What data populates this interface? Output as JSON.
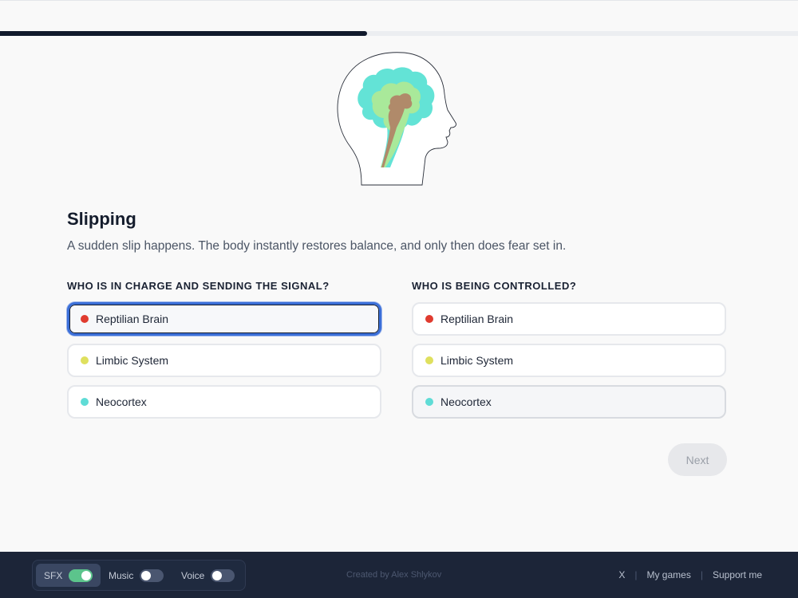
{
  "progress": {
    "fraction": 0.46
  },
  "illustration": {
    "icon": "brain-head-icon"
  },
  "question": {
    "title": "Slipping",
    "description": "A sudden slip happens. The body instantly restores balance, and only then does fear set in."
  },
  "left_column": {
    "heading": "WHO IS IN CHARGE AND SENDING THE SIGNAL?",
    "options": [
      {
        "label": "Reptilian Brain",
        "color": "#e03b2f",
        "state": "selected"
      },
      {
        "label": "Limbic System",
        "color": "#dfe05e",
        "state": "default"
      },
      {
        "label": "Neocortex",
        "color": "#5fdcd6",
        "state": "default"
      }
    ]
  },
  "right_column": {
    "heading": "WHO IS BEING CONTROLLED?",
    "options": [
      {
        "label": "Reptilian Brain",
        "color": "#e03b2f",
        "state": "default"
      },
      {
        "label": "Limbic System",
        "color": "#dfe05e",
        "state": "default"
      },
      {
        "label": "Neocortex",
        "color": "#5fdcd6",
        "state": "hover"
      }
    ]
  },
  "next_button": {
    "label": "Next",
    "disabled": true
  },
  "footer": {
    "audio": [
      {
        "label": "SFX",
        "on": true
      },
      {
        "label": "Music",
        "on": false
      },
      {
        "label": "Voice",
        "on": false
      }
    ],
    "credit": "Created by Alex Shlykov",
    "links": [
      "X",
      "My games",
      "Support me"
    ]
  }
}
